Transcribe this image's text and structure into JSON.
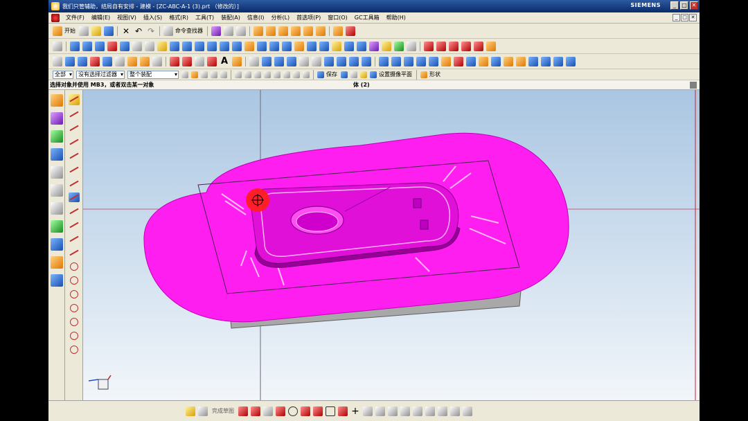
{
  "window": {
    "title": "我们只管辅助，结局自有安排 - 建模 - [ZC-ABC-A-1 (3).prt （修改的）]",
    "brand": "SIEMENS",
    "buttons": [
      "_",
      "□",
      "✕"
    ]
  },
  "menu": {
    "items": [
      "文件(F)",
      "编辑(E)",
      "视图(V)",
      "插入(S)",
      "格式(R)",
      "工具(T)",
      "装配(A)",
      "信息(I)",
      "分析(L)",
      "首选项(P)",
      "窗口(O)",
      "GC工具箱",
      "帮助(H)"
    ],
    "doc_buttons": [
      "_",
      "□",
      "✕"
    ]
  },
  "toolbar_standard": {
    "start_label": "开始",
    "command_finder_label": "命令查找器"
  },
  "selection_bar": {
    "filter_value": "全部",
    "selection_filter": "没有选择过滤器",
    "assembly_scope": "整个装配",
    "save_label": "保存",
    "wcs_label": "设置摄像平面",
    "shape_label": "形状"
  },
  "cue": {
    "prompt": "选择对象并使用 MB3，或者双击某一对象",
    "status": "体 (2)"
  },
  "bottom": {
    "sketch_label": "完成草图"
  },
  "colors": {
    "highlight": "#ff1ef0",
    "body_edge": "#d000c8",
    "viewport_top": "#aac6e2",
    "viewport_bottom": "#f2f6fa",
    "title_bar": "#0a2a6a"
  },
  "icons": {
    "start": "start-icon",
    "new": "new-file-icon",
    "open": "open-folder-icon",
    "save": "save-icon",
    "undo": "undo-icon",
    "redo": "redo-icon",
    "cursor": "selection-cursor-icon",
    "wcs": "coordinate-triad-icon"
  }
}
